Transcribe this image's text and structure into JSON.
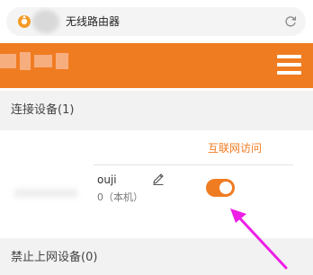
{
  "browser": {
    "tab_title": "无线路由器",
    "icons": {
      "site": "router-logo-icon",
      "reload": "reload-icon"
    }
  },
  "header": {
    "accent_color": "#f07c22",
    "menu_icon": "hamburger-menu-icon"
  },
  "connected_section": {
    "title": "连接设备(1)",
    "column_header": "互联网访问",
    "devices": [
      {
        "name": "ouji",
        "subtitle": "0（本机）",
        "internet_access_enabled": true,
        "edit_icon": "pencil-edit-icon"
      }
    ]
  },
  "blocked_section": {
    "title": "禁止上网设备(0)"
  },
  "annotation": {
    "arrow_color": "#ee1ee6"
  }
}
